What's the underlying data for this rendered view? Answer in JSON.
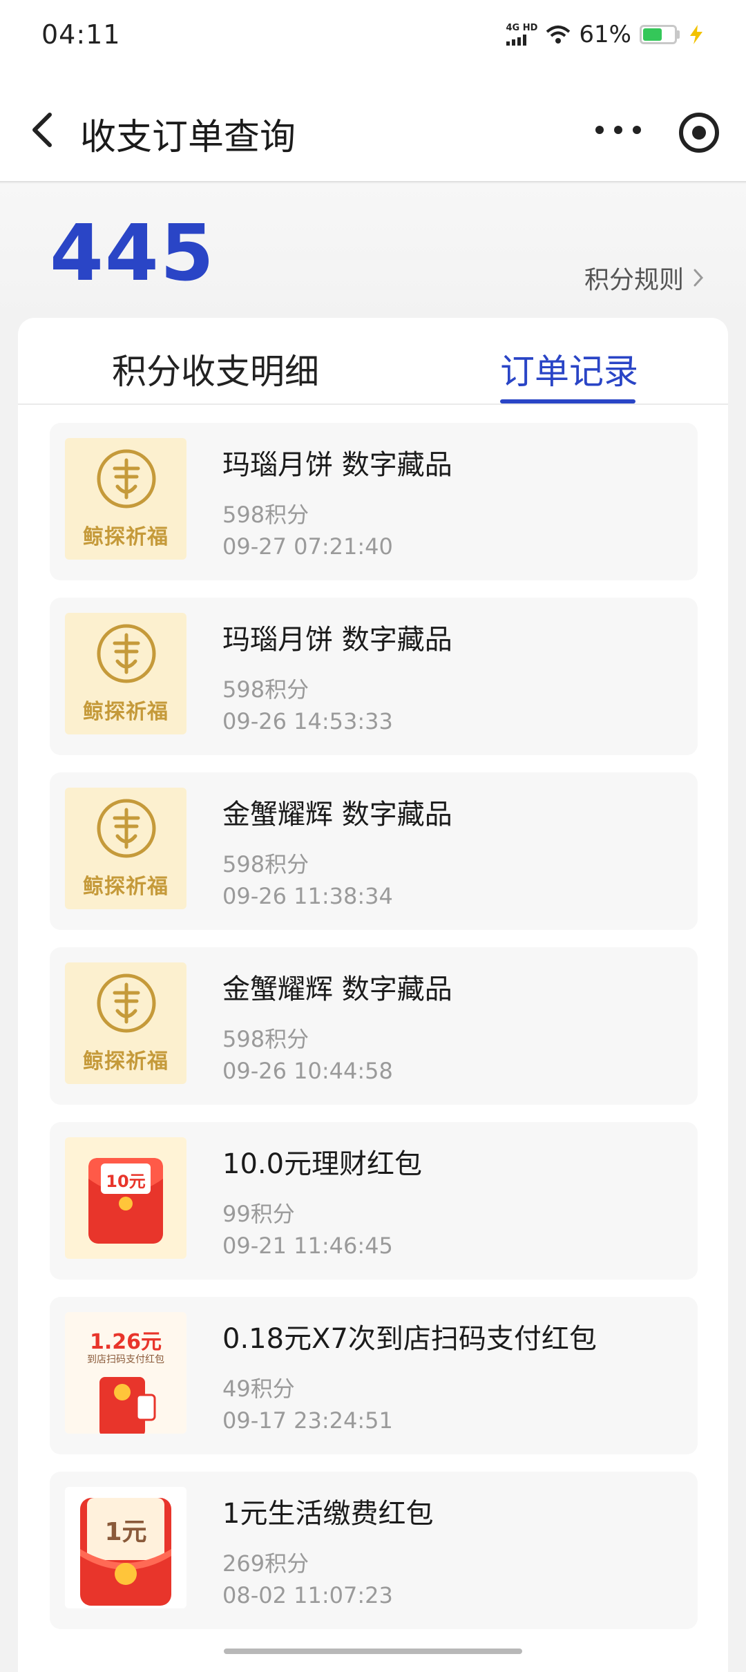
{
  "status_bar": {
    "time": "04:11",
    "network": "4G HD",
    "battery": "61%",
    "battery_level": 0.61
  },
  "header": {
    "title": "收支订单查询"
  },
  "summary": {
    "points": "445",
    "rules_link": "积分规则"
  },
  "tabs": [
    {
      "label": "积分收支明细",
      "active": false
    },
    {
      "label": "订单记录",
      "active": true
    }
  ],
  "orders": [
    {
      "name": "玛瑙月饼 数字藏品",
      "points": "598积分",
      "time": "09-27 07:21:40",
      "thumb": "blessing",
      "thumb_caption": "鲸探祈福"
    },
    {
      "name": "玛瑙月饼 数字藏品",
      "points": "598积分",
      "time": "09-26 14:53:33",
      "thumb": "blessing",
      "thumb_caption": "鲸探祈福"
    },
    {
      "name": "金蟹耀辉 数字藏品",
      "points": "598积分",
      "time": "09-26 11:38:34",
      "thumb": "blessing",
      "thumb_caption": "鲸探祈福"
    },
    {
      "name": "金蟹耀辉 数字藏品",
      "points": "598积分",
      "time": "09-26 10:44:58",
      "thumb": "blessing",
      "thumb_caption": "鲸探祈福"
    },
    {
      "name": "10.0元理财红包",
      "points": "99积分",
      "time": "09-21 11:46:45",
      "thumb": "red-envelope",
      "thumb_caption": "10元"
    },
    {
      "name": "0.18元X7次到店扫码支付红包",
      "points": "49积分",
      "time": "09-17 23:24:51",
      "thumb": "scan-envelope",
      "thumb_caption": "1.26元",
      "thumb_subcaption": "到店扫码支付红包"
    },
    {
      "name": "1元生活缴费红包",
      "points": "269积分",
      "time": "08-02 11:07:23",
      "thumb": "bill-envelope",
      "thumb_caption": "1元"
    }
  ],
  "colors": {
    "accent": "#2a45c6",
    "gold": "#c59a3a",
    "envelope_red": "#e8352b"
  }
}
